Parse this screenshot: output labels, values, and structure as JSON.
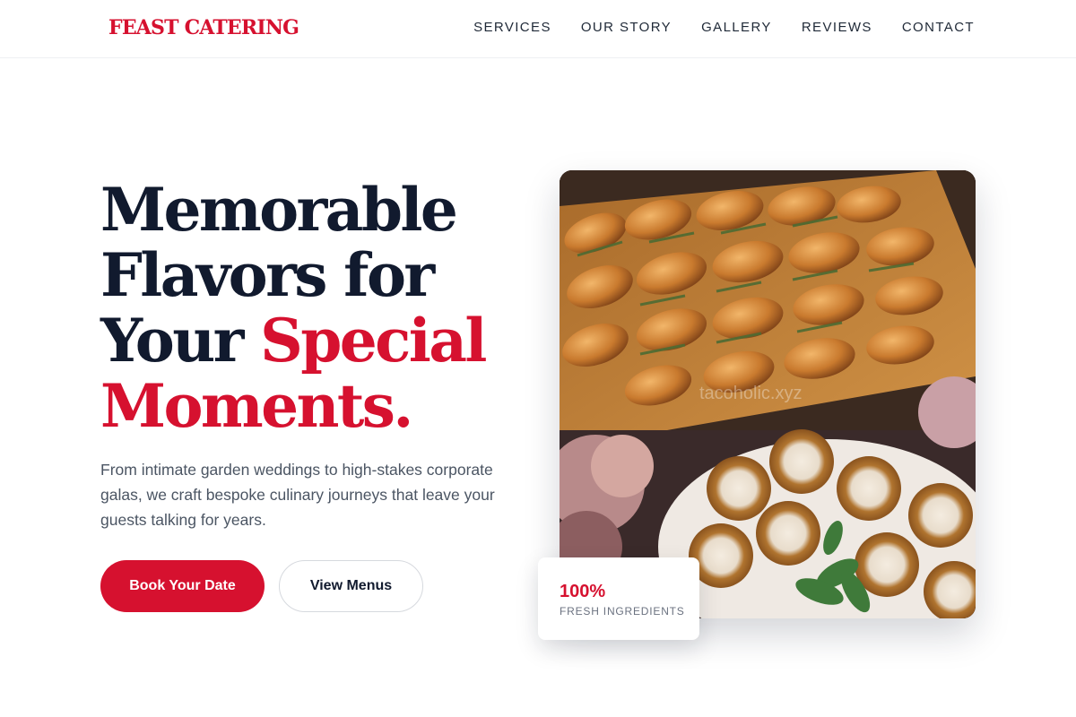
{
  "brand": {
    "logo_text": "FEAST CATERING",
    "primary_color": "#d6112f",
    "heading_color": "#111a2e"
  },
  "nav": {
    "items": [
      {
        "label": "SERVICES"
      },
      {
        "label": "OUR STORY"
      },
      {
        "label": "GALLERY"
      },
      {
        "label": "REVIEWS"
      },
      {
        "label": "CONTACT"
      }
    ]
  },
  "hero": {
    "headline_line1": "Memorable",
    "headline_line2": "Flavors for",
    "headline_line3_plain": "Your ",
    "headline_line3_accent": "Special",
    "headline_line4_accent": "Moments.",
    "lead": "From intimate garden weddings to high-stakes corporate galas, we craft bespoke culinary journeys that leave your guests talking for years.",
    "primary_button": "Book Your Date",
    "secondary_button": "View Menus"
  },
  "photo": {
    "watermark": "tacoholic.xyz"
  },
  "stat": {
    "value": "100%",
    "label": "FRESH INGREDIENTS"
  }
}
